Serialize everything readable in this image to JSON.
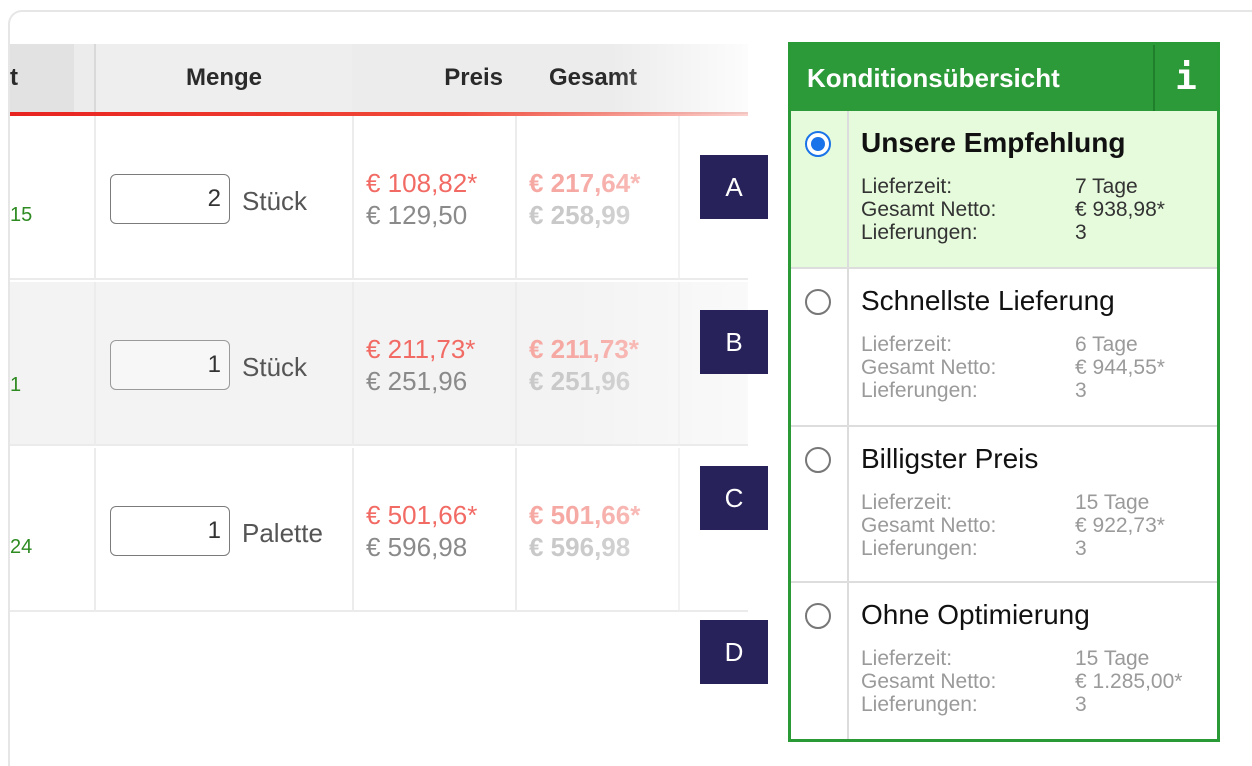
{
  "table": {
    "headers": {
      "artikel": "t",
      "menge": "Menge",
      "preis": "Preis",
      "gesamt": "Gesamt"
    },
    "rows": [
      {
        "article_fragment": "15",
        "qty": "2",
        "unit": "Stück",
        "preis_net": "€ 108,82*",
        "preis_gross": "€ 129,50",
        "gesamt_net": "€ 217,64*",
        "gesamt_gross": "€ 258,99"
      },
      {
        "article_fragment": "1",
        "qty": "1",
        "unit": "Stück",
        "preis_net": "€ 211,73*",
        "preis_gross": "€ 251,96",
        "gesamt_net": "€ 211,73*",
        "gesamt_gross": "€ 251,96"
      },
      {
        "article_fragment": "24",
        "qty": "1",
        "unit": "Palette",
        "preis_net": "€ 501,66*",
        "preis_gross": "€ 596,98",
        "gesamt_net": "€ 501,66*",
        "gesamt_gross": "€ 596,98"
      }
    ]
  },
  "badges": [
    "A",
    "B",
    "C",
    "D"
  ],
  "panel": {
    "title": "Konditionsübersicht",
    "info_glyph": "i",
    "labels": {
      "lieferzeit": "Lieferzeit:",
      "netto": "Gesamt Netto:",
      "lieferungen": "Lieferungen:"
    },
    "options": [
      {
        "title": "Unsere Empfehlung",
        "lieferzeit": "7 Tage",
        "netto": "€ 938,98*",
        "lieferungen": "3",
        "selected": true
      },
      {
        "title": "Schnellste Lieferung",
        "lieferzeit": "6 Tage",
        "netto": "€ 944,55*",
        "lieferungen": "3",
        "selected": false
      },
      {
        "title": "Billigster Preis",
        "lieferzeit": "15 Tage",
        "netto": "€ 922,73*",
        "lieferungen": "3",
        "selected": false
      },
      {
        "title": "Ohne Optimierung",
        "lieferzeit": "15 Tage",
        "netto": "€ 1.285,00*",
        "lieferungen": "3",
        "selected": false
      }
    ]
  },
  "colors": {
    "accent_green": "#2d9a39",
    "selected_bg": "#e6fbdc",
    "radio_blue": "#1a73e8",
    "badge_navy": "#27235a",
    "price_red": "#f26a64"
  }
}
